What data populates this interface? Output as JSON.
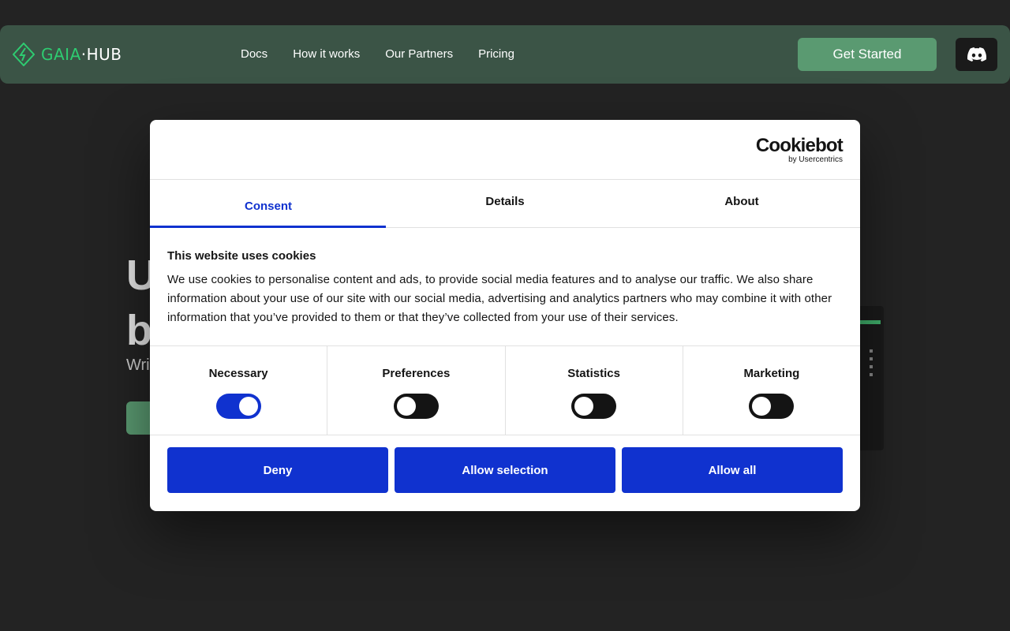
{
  "header": {
    "brand": {
      "part1": "GAIA",
      "part2": "·HUB"
    },
    "nav": [
      "Docs",
      "How it works",
      "Our Partners",
      "Pricing"
    ],
    "cta_label": "Get Started",
    "discord_icon": "discord-icon"
  },
  "hero": {
    "line1": "U",
    "line2": "b",
    "subtitle": "Wri"
  },
  "cookie": {
    "logo_main": "Cookiebot",
    "logo_sub": "by Usercentrics",
    "tabs": [
      "Consent",
      "Details",
      "About"
    ],
    "active_tab": "Consent",
    "title": "This website uses cookies",
    "description": "We use cookies to personalise content and ads, to provide social media features and to analyse our traffic. We also share information about your use of our site with our social media, advertising and analytics partners who may combine it with other information that you’ve provided to them or that they’ve collected from your use of their services.",
    "toggles": [
      {
        "label": "Necessary",
        "on": true
      },
      {
        "label": "Preferences",
        "on": false
      },
      {
        "label": "Statistics",
        "on": false
      },
      {
        "label": "Marketing",
        "on": false
      }
    ],
    "buttons": [
      "Deny",
      "Allow selection",
      "Allow all"
    ]
  },
  "colors": {
    "page_bg": "#232323",
    "header_bg": "#3b5446",
    "cta": "#5a9a71",
    "consent_blue": "#1032cf"
  }
}
